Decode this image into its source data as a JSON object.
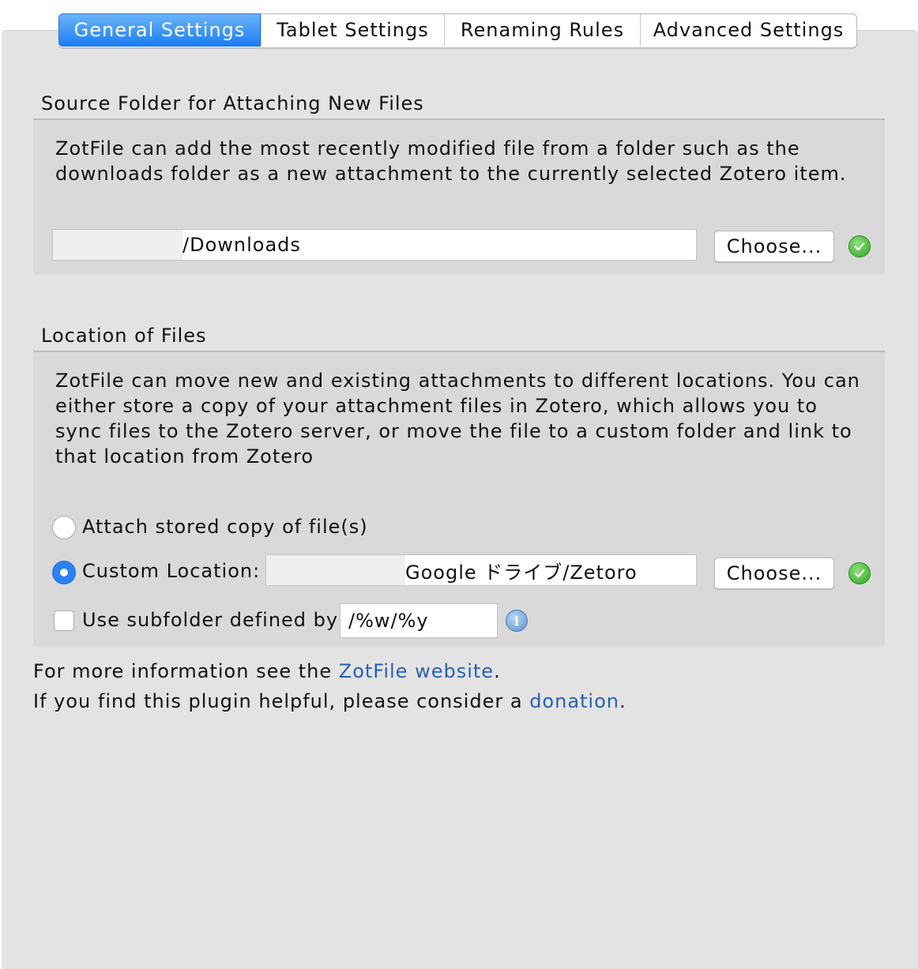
{
  "tabs": [
    {
      "label": "General Settings",
      "active": true
    },
    {
      "label": "Tablet Settings",
      "active": false
    },
    {
      "label": "Renaming Rules",
      "active": false
    },
    {
      "label": "Advanced Settings",
      "active": false
    }
  ],
  "source_folder": {
    "title": "Source Folder for Attaching New Files",
    "description": "ZotFile can add the most recently modified file from a folder such as the downloads folder as a new attachment to the currently selected Zotero item.",
    "path_value": "/Downloads",
    "choose_label": "Choose..."
  },
  "location": {
    "title": "Location of Files",
    "description": "ZotFile can move new and existing attachments to different locations. You can either store a copy of your attachment files in Zotero, which allows you to sync files to the Zotero server, or move the file to a custom folder and link to that location from Zotero",
    "option_stored": "Attach stored copy of file(s)",
    "option_custom": "Custom Location:",
    "custom_path_value": "Google ドライブ/Zetoro",
    "choose_label": "Choose...",
    "subfolder_label": "Use subfolder defined by",
    "subfolder_value": "/%w/%y"
  },
  "footer": {
    "info_prefix": "For more information see the ",
    "info_link": "ZotFile website",
    "info_suffix": ".",
    "donate_prefix": "If you find this plugin helpful, please consider a ",
    "donate_link": "donation",
    "donate_suffix": "."
  },
  "colors": {
    "accent": "#1b7ef4",
    "link": "#2a5fb0",
    "ok_green": "#2fa523"
  }
}
